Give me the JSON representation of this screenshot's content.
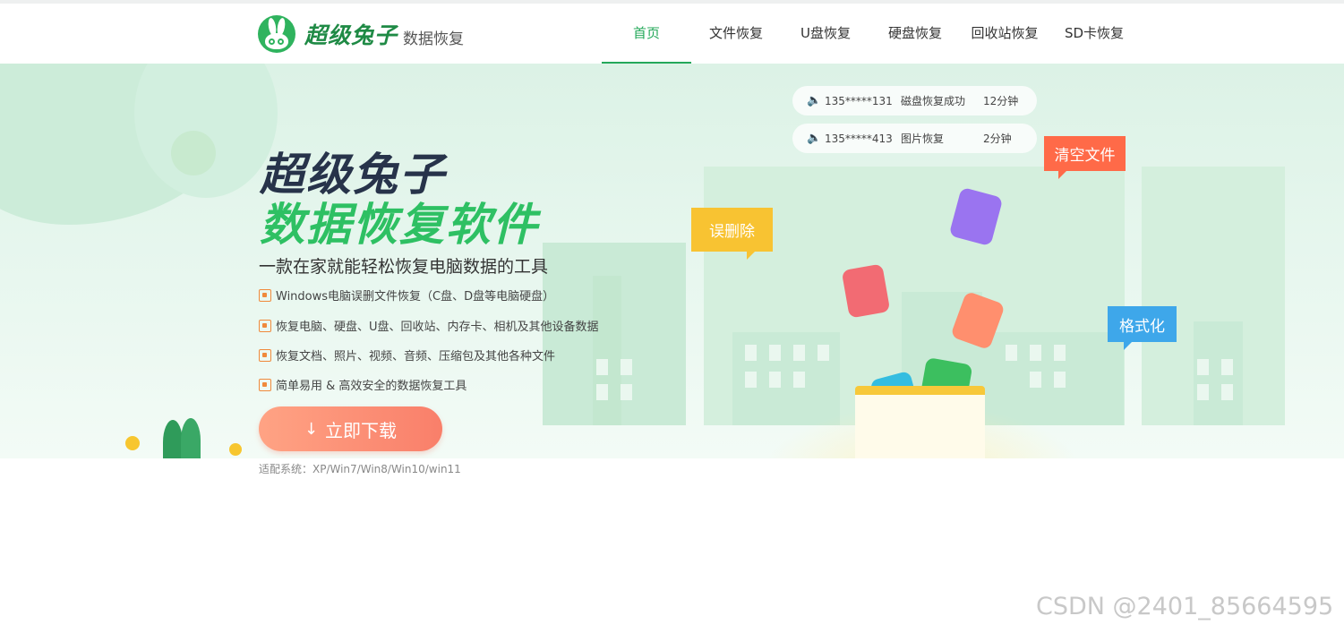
{
  "header": {
    "logo_brand": "超级兔子",
    "logo_sub": "数据恢复",
    "nav": [
      {
        "label": "首页",
        "active": true
      },
      {
        "label": "文件恢复",
        "active": false
      },
      {
        "label": "U盘恢复",
        "active": false
      },
      {
        "label": "硬盘恢复",
        "active": false
      },
      {
        "label": "回收站恢复",
        "active": false
      },
      {
        "label": "SD卡恢复",
        "active": false
      }
    ]
  },
  "hero": {
    "title_line1": "超级兔子",
    "title_line2": "数据恢复软件",
    "description": "一款在家就能轻松恢复电脑数据的工具",
    "features": [
      "Windows电脑误删文件恢复（C盘、D盘等电脑硬盘）",
      "恢复电脑、硬盘、U盘、回收站、内存卡、相机及其他设备数据",
      "恢复文档、照片、视频、音频、压缩包及其他各种文件",
      "简单易用 & 高效安全的数据恢复工具"
    ],
    "download_label": "立即下载",
    "compat_text": "适配系统：XP/Win7/Win8/Win10/win11",
    "tickers": [
      {
        "phone": "135*****131",
        "action": "磁盘恢复成功",
        "time": "12分钟"
      },
      {
        "phone": "135*****413",
        "action": "图片恢复",
        "time": "2分钟"
      }
    ],
    "tags": {
      "deleted": "误删除",
      "clear": "清空文件",
      "format": "格式化"
    }
  },
  "watermark": "CSDN @2401_85664595",
  "colors": {
    "accent_green": "#24a85a",
    "title_dark": "#27334a",
    "title_green": "#2ec063",
    "button_orange": "#f97f6a",
    "tag_yellow": "#f8c332",
    "tag_red": "#ff6a48",
    "tag_blue": "#3ea7ea"
  }
}
